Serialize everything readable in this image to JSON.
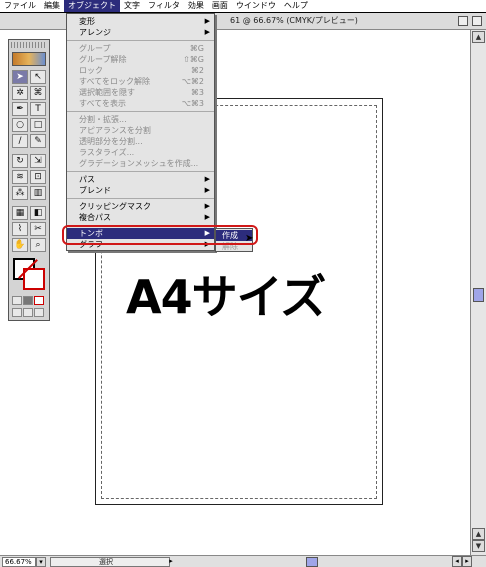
{
  "menubar": {
    "items": [
      "ファイル",
      "編集",
      "オブジェクト",
      "文字",
      "フィルタ",
      "効果",
      "画面",
      "ウインドウ",
      "ヘルプ"
    ]
  },
  "window": {
    "title": "61 @ 66.67% (CMYK/プレビュー)"
  },
  "canvas": {
    "text": "A4サイズ"
  },
  "object_menu": {
    "items": [
      {
        "label": "変形",
        "submenu": true,
        "disabled": false
      },
      {
        "label": "アレンジ",
        "submenu": true,
        "disabled": false
      },
      {
        "label": "グループ",
        "shortcut": "⌘G",
        "disabled": true
      },
      {
        "label": "グループ解除",
        "shortcut": "⇧⌘G",
        "disabled": true
      },
      {
        "label": "ロック",
        "shortcut": "⌘2",
        "disabled": true
      },
      {
        "label": "すべてをロック解除",
        "shortcut": "⌥⌘2",
        "disabled": true
      },
      {
        "label": "選択範囲を隠す",
        "shortcut": "⌘3",
        "disabled": true
      },
      {
        "label": "すべてを表示",
        "shortcut": "⌥⌘3",
        "disabled": true
      },
      {
        "label": "分割・拡張...",
        "disabled": true
      },
      {
        "label": "アピアランスを分割",
        "disabled": true
      },
      {
        "label": "透明部分を分割...",
        "disabled": true
      },
      {
        "label": "ラスタライズ...",
        "disabled": true
      },
      {
        "label": "グラデーションメッシュを作成...",
        "disabled": true
      },
      {
        "label": "パス",
        "submenu": true,
        "disabled": false
      },
      {
        "label": "ブレンド",
        "submenu": true,
        "disabled": false
      },
      {
        "label": "クリッピングマスク",
        "submenu": true,
        "disabled": false
      },
      {
        "label": "複合パス",
        "submenu": true,
        "disabled": false
      },
      {
        "label": "トンボ",
        "submenu": true,
        "disabled": false,
        "highlighted": true
      },
      {
        "label": "グラフ",
        "submenu": true,
        "disabled": false
      }
    ]
  },
  "tombo_submenu": {
    "items": [
      {
        "label": "作成",
        "highlighted": true
      },
      {
        "label": "解除",
        "disabled": true
      }
    ]
  },
  "statusbar": {
    "zoom": "66.67%",
    "status": "選択"
  },
  "colors": {
    "highlight": "#2c2c7c",
    "annotation_ring": "#d01818"
  }
}
